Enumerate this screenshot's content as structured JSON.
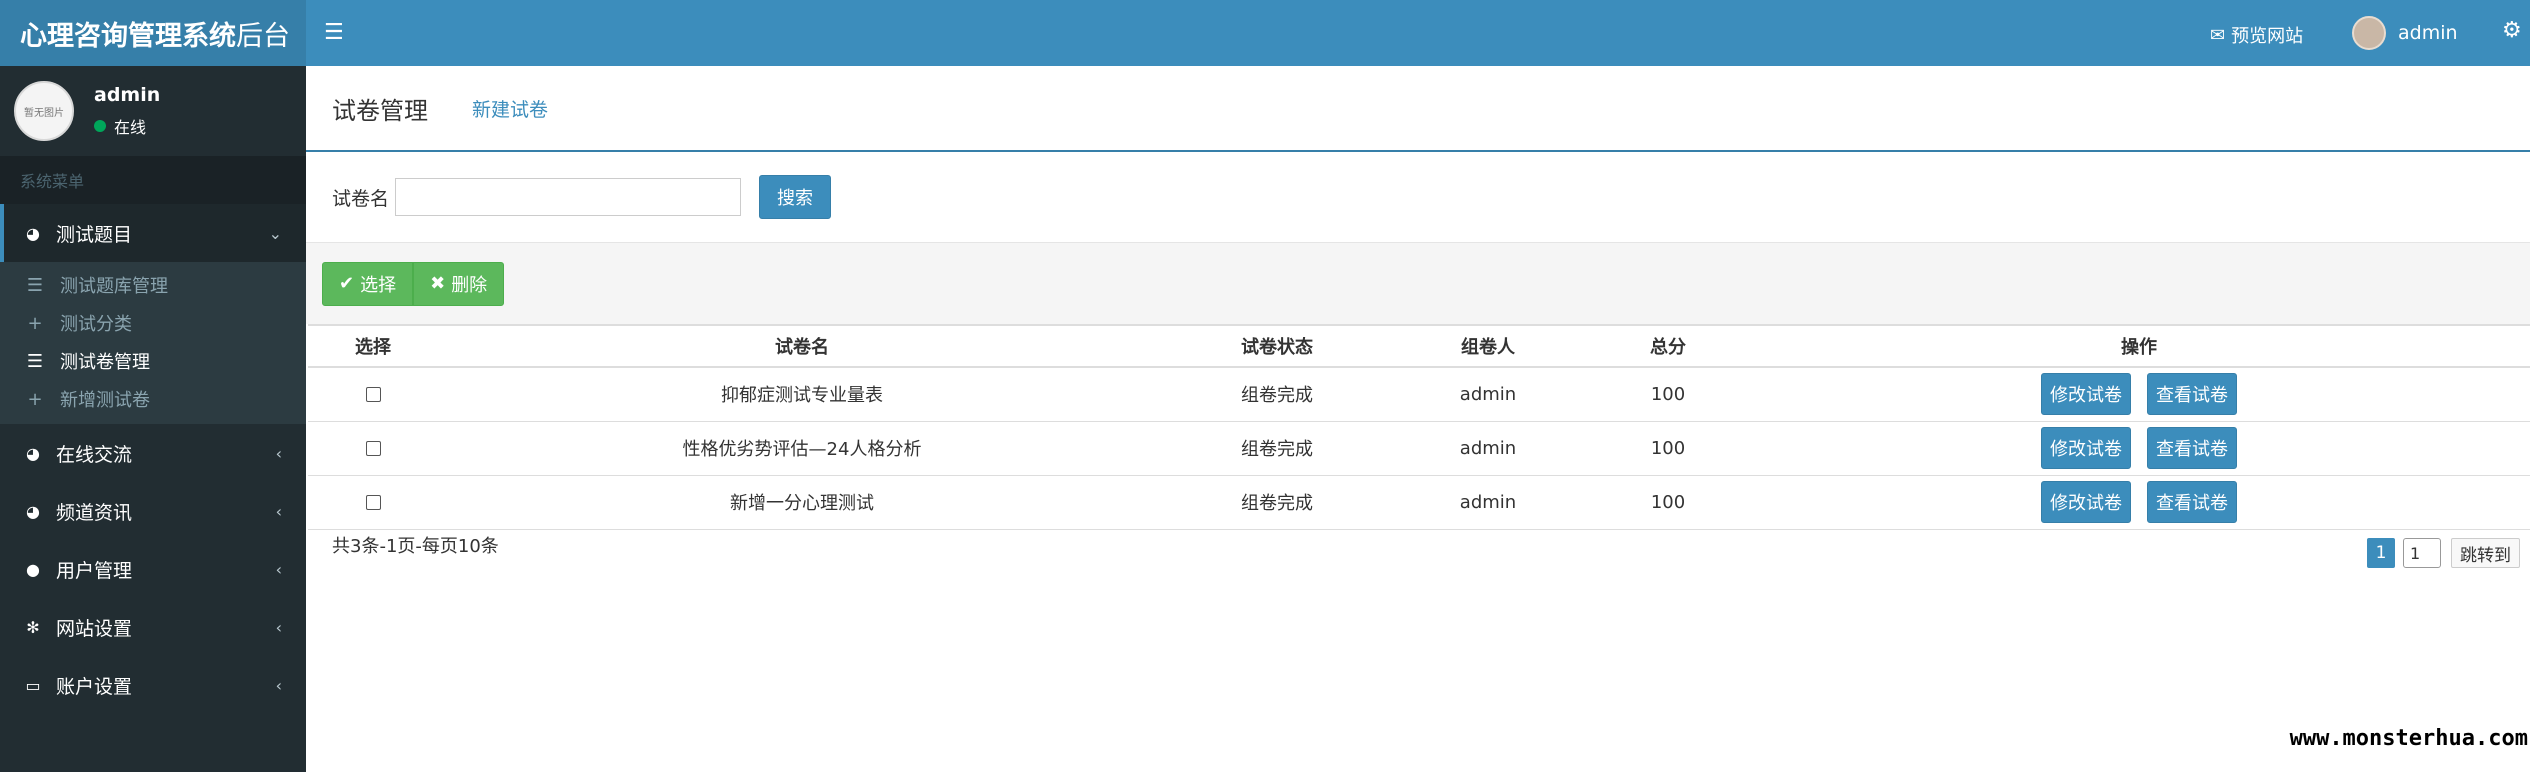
{
  "app": {
    "title_bold": "心理咨询管理系统",
    "title_light": "后台"
  },
  "user_panel": {
    "avatar_text": "暂无图片",
    "name": "admin",
    "status": "在线",
    "status_color": "#00a65a"
  },
  "sidebar": {
    "header": "系统菜单",
    "active_menu": {
      "icon": "pie-chart-icon",
      "label": "测试题目",
      "arrow": "chevron-down-icon",
      "subitems": [
        {
          "icon": "list-icon",
          "label": "测试题库管理"
        },
        {
          "icon": "plus-icon",
          "label": "测试分类"
        },
        {
          "icon": "list-icon",
          "label": "测试卷管理"
        },
        {
          "icon": "plus-icon",
          "label": "新增测试卷"
        }
      ]
    },
    "menus": [
      {
        "icon": "pie-chart-icon",
        "label": "在线交流"
      },
      {
        "icon": "pie-chart-icon",
        "label": "频道资讯"
      },
      {
        "icon": "user-icon",
        "label": "用户管理"
      },
      {
        "icon": "gear-icon",
        "label": "网站设置"
      },
      {
        "icon": "laptop-icon",
        "label": "账户设置"
      }
    ]
  },
  "topbar": {
    "preview_label": "预览网站",
    "user": "admin"
  },
  "page": {
    "title": "试卷管理",
    "new_link": "新建试卷"
  },
  "search": {
    "label": "试卷名",
    "value": "",
    "button": "搜索"
  },
  "toolbar": {
    "select_label": "选择",
    "delete_label": "删除"
  },
  "table": {
    "headers": [
      "选择",
      "试卷名",
      "试卷状态",
      "组卷人",
      "总分",
      "操作"
    ],
    "rows": [
      {
        "name": "抑郁症测试专业量表",
        "status": "组卷完成",
        "author": "admin",
        "score": "100"
      },
      {
        "name": "性格优劣势评估—24人格分析",
        "status": "组卷完成",
        "author": "admin",
        "score": "100"
      },
      {
        "name": "新增一分心理测试",
        "status": "组卷完成",
        "author": "admin",
        "score": "100"
      }
    ],
    "edit_label": "修改试卷",
    "view_label": "查看试卷"
  },
  "pagination": {
    "summary": "共3条-1页-每页10条",
    "current_page": "1",
    "input_value": "1",
    "jump_label": "跳转到"
  },
  "watermark": "www.monsterhua.com",
  "colors": {
    "brand_dark": "#367fa9",
    "brand": "#3c8dbc",
    "sidebar_bg": "#222d32",
    "success": "#5cb85c"
  }
}
